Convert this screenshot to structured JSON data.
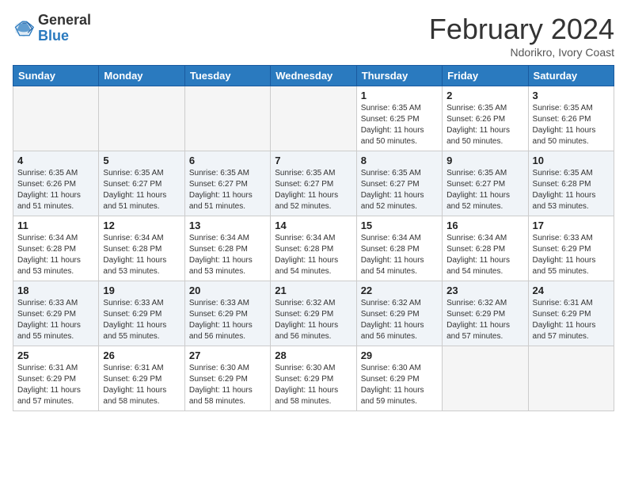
{
  "header": {
    "logo_general": "General",
    "logo_blue": "Blue",
    "title": "February 2024",
    "subtitle": "Ndorikro, Ivory Coast"
  },
  "weekdays": [
    "Sunday",
    "Monday",
    "Tuesday",
    "Wednesday",
    "Thursday",
    "Friday",
    "Saturday"
  ],
  "weeks": [
    [
      {
        "day": "",
        "info": ""
      },
      {
        "day": "",
        "info": ""
      },
      {
        "day": "",
        "info": ""
      },
      {
        "day": "",
        "info": ""
      },
      {
        "day": "1",
        "info": "Sunrise: 6:35 AM\nSunset: 6:25 PM\nDaylight: 11 hours\nand 50 minutes."
      },
      {
        "day": "2",
        "info": "Sunrise: 6:35 AM\nSunset: 6:26 PM\nDaylight: 11 hours\nand 50 minutes."
      },
      {
        "day": "3",
        "info": "Sunrise: 6:35 AM\nSunset: 6:26 PM\nDaylight: 11 hours\nand 50 minutes."
      }
    ],
    [
      {
        "day": "4",
        "info": "Sunrise: 6:35 AM\nSunset: 6:26 PM\nDaylight: 11 hours\nand 51 minutes."
      },
      {
        "day": "5",
        "info": "Sunrise: 6:35 AM\nSunset: 6:27 PM\nDaylight: 11 hours\nand 51 minutes."
      },
      {
        "day": "6",
        "info": "Sunrise: 6:35 AM\nSunset: 6:27 PM\nDaylight: 11 hours\nand 51 minutes."
      },
      {
        "day": "7",
        "info": "Sunrise: 6:35 AM\nSunset: 6:27 PM\nDaylight: 11 hours\nand 52 minutes."
      },
      {
        "day": "8",
        "info": "Sunrise: 6:35 AM\nSunset: 6:27 PM\nDaylight: 11 hours\nand 52 minutes."
      },
      {
        "day": "9",
        "info": "Sunrise: 6:35 AM\nSunset: 6:27 PM\nDaylight: 11 hours\nand 52 minutes."
      },
      {
        "day": "10",
        "info": "Sunrise: 6:35 AM\nSunset: 6:28 PM\nDaylight: 11 hours\nand 53 minutes."
      }
    ],
    [
      {
        "day": "11",
        "info": "Sunrise: 6:34 AM\nSunset: 6:28 PM\nDaylight: 11 hours\nand 53 minutes."
      },
      {
        "day": "12",
        "info": "Sunrise: 6:34 AM\nSunset: 6:28 PM\nDaylight: 11 hours\nand 53 minutes."
      },
      {
        "day": "13",
        "info": "Sunrise: 6:34 AM\nSunset: 6:28 PM\nDaylight: 11 hours\nand 53 minutes."
      },
      {
        "day": "14",
        "info": "Sunrise: 6:34 AM\nSunset: 6:28 PM\nDaylight: 11 hours\nand 54 minutes."
      },
      {
        "day": "15",
        "info": "Sunrise: 6:34 AM\nSunset: 6:28 PM\nDaylight: 11 hours\nand 54 minutes."
      },
      {
        "day": "16",
        "info": "Sunrise: 6:34 AM\nSunset: 6:28 PM\nDaylight: 11 hours\nand 54 minutes."
      },
      {
        "day": "17",
        "info": "Sunrise: 6:33 AM\nSunset: 6:29 PM\nDaylight: 11 hours\nand 55 minutes."
      }
    ],
    [
      {
        "day": "18",
        "info": "Sunrise: 6:33 AM\nSunset: 6:29 PM\nDaylight: 11 hours\nand 55 minutes."
      },
      {
        "day": "19",
        "info": "Sunrise: 6:33 AM\nSunset: 6:29 PM\nDaylight: 11 hours\nand 55 minutes."
      },
      {
        "day": "20",
        "info": "Sunrise: 6:33 AM\nSunset: 6:29 PM\nDaylight: 11 hours\nand 56 minutes."
      },
      {
        "day": "21",
        "info": "Sunrise: 6:32 AM\nSunset: 6:29 PM\nDaylight: 11 hours\nand 56 minutes."
      },
      {
        "day": "22",
        "info": "Sunrise: 6:32 AM\nSunset: 6:29 PM\nDaylight: 11 hours\nand 56 minutes."
      },
      {
        "day": "23",
        "info": "Sunrise: 6:32 AM\nSunset: 6:29 PM\nDaylight: 11 hours\nand 57 minutes."
      },
      {
        "day": "24",
        "info": "Sunrise: 6:31 AM\nSunset: 6:29 PM\nDaylight: 11 hours\nand 57 minutes."
      }
    ],
    [
      {
        "day": "25",
        "info": "Sunrise: 6:31 AM\nSunset: 6:29 PM\nDaylight: 11 hours\nand 57 minutes."
      },
      {
        "day": "26",
        "info": "Sunrise: 6:31 AM\nSunset: 6:29 PM\nDaylight: 11 hours\nand 58 minutes."
      },
      {
        "day": "27",
        "info": "Sunrise: 6:30 AM\nSunset: 6:29 PM\nDaylight: 11 hours\nand 58 minutes."
      },
      {
        "day": "28",
        "info": "Sunrise: 6:30 AM\nSunset: 6:29 PM\nDaylight: 11 hours\nand 58 minutes."
      },
      {
        "day": "29",
        "info": "Sunrise: 6:30 AM\nSunset: 6:29 PM\nDaylight: 11 hours\nand 59 minutes."
      },
      {
        "day": "",
        "info": ""
      },
      {
        "day": "",
        "info": ""
      }
    ]
  ]
}
